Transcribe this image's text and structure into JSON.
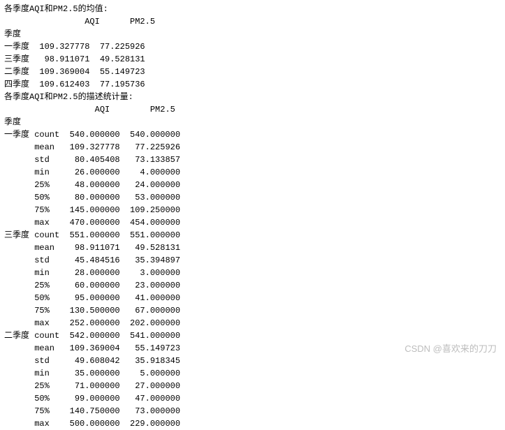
{
  "section1": {
    "title": "各季度AQI和PM2.5的均值:",
    "header": "                AQI      PM2.5",
    "index_label": "季度",
    "rows": [
      {
        "label": "一季度",
        "aqi": "109.327778",
        "pm25": "77.225926"
      },
      {
        "label": "三季度",
        "aqi": " 98.911071",
        "pm25": "49.528131"
      },
      {
        "label": "二季度",
        "aqi": "109.369004",
        "pm25": "55.149723"
      },
      {
        "label": "四季度",
        "aqi": "109.612403",
        "pm25": "77.195736"
      }
    ]
  },
  "section2": {
    "title": "各季度AQI和PM2.5的描述统计量:",
    "header": "                  AQI        PM2.5",
    "index_label": "季度",
    "groups": [
      {
        "group_label": "一季度 count  540.000000  540.000000",
        "stats": [
          {
            "stat": "mean   109.327778   77.225926"
          },
          {
            "stat": "std     80.405408   73.133857"
          },
          {
            "stat": "min     26.000000    4.000000"
          },
          {
            "stat": "25%     48.000000   24.000000"
          },
          {
            "stat": "50%     80.000000   53.000000"
          },
          {
            "stat": "75%    145.000000  109.250000"
          },
          {
            "stat": "max    470.000000  454.000000"
          }
        ]
      },
      {
        "group_label": "三季度 count  551.000000  551.000000",
        "stats": [
          {
            "stat": "mean    98.911071   49.528131"
          },
          {
            "stat": "std     45.484516   35.394897"
          },
          {
            "stat": "min     28.000000    3.000000"
          },
          {
            "stat": "25%     60.000000   23.000000"
          },
          {
            "stat": "50%     95.000000   41.000000"
          },
          {
            "stat": "75%    130.500000   67.000000"
          },
          {
            "stat": "max    252.000000  202.000000"
          }
        ]
      },
      {
        "group_label": "二季度 count  542.000000  541.000000",
        "stats": [
          {
            "stat": "mean   109.369004   55.149723"
          },
          {
            "stat": "std     49.608042   35.918345"
          },
          {
            "stat": "min     35.000000    5.000000"
          },
          {
            "stat": "25%     71.000000   27.000000"
          },
          {
            "stat": "50%     99.000000   47.000000"
          },
          {
            "stat": "75%    140.750000   73.000000"
          },
          {
            "stat": "max    500.000000  229.000000"
          }
        ]
      }
    ]
  },
  "watermark": "CSDN @喜欢来的刀刀",
  "chart_data": {
    "type": "table",
    "title_means": "各季度AQI和PM2.5的均值",
    "means": {
      "index": [
        "一季度",
        "三季度",
        "二季度",
        "四季度"
      ],
      "columns": [
        "AQI",
        "PM2.5"
      ],
      "data": [
        [
          109.327778,
          77.225926
        ],
        [
          98.911071,
          49.528131
        ],
        [
          109.369004,
          55.149723
        ],
        [
          109.612403,
          77.195736
        ]
      ]
    },
    "title_describe": "各季度AQI和PM2.5的描述统计量",
    "describe": {
      "一季度": {
        "AQI": {
          "count": 540.0,
          "mean": 109.327778,
          "std": 80.405408,
          "min": 26.0,
          "25%": 48.0,
          "50%": 80.0,
          "75%": 145.0,
          "max": 470.0
        },
        "PM2.5": {
          "count": 540.0,
          "mean": 77.225926,
          "std": 73.133857,
          "min": 4.0,
          "25%": 24.0,
          "50%": 53.0,
          "75%": 109.25,
          "max": 454.0
        }
      },
      "三季度": {
        "AQI": {
          "count": 551.0,
          "mean": 98.911071,
          "std": 45.484516,
          "min": 28.0,
          "25%": 60.0,
          "50%": 95.0,
          "75%": 130.5,
          "max": 252.0
        },
        "PM2.5": {
          "count": 551.0,
          "mean": 49.528131,
          "std": 35.394897,
          "min": 3.0,
          "25%": 23.0,
          "50%": 41.0,
          "75%": 67.0,
          "max": 202.0
        }
      },
      "二季度": {
        "AQI": {
          "count": 542.0,
          "mean": 109.369004,
          "std": 49.608042,
          "min": 35.0,
          "25%": 71.0,
          "50%": 99.0,
          "75%": 140.75,
          "max": 500.0
        },
        "PM2.5": {
          "count": 541.0,
          "mean": 55.149723,
          "std": 35.918345,
          "min": 5.0,
          "25%": 27.0,
          "50%": 47.0,
          "75%": 73.0,
          "max": 229.0
        }
      }
    }
  }
}
